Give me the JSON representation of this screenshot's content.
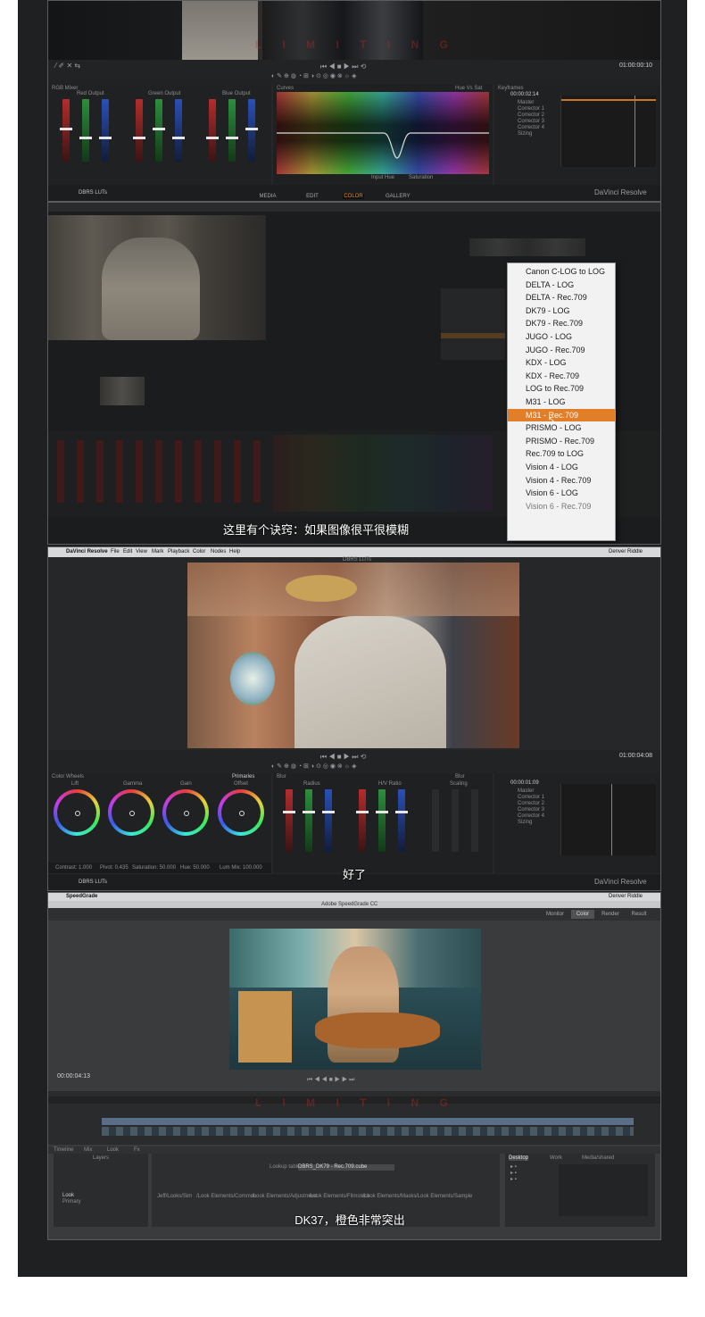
{
  "panel1": {
    "timecode": "01:00:00:10",
    "rgb_mixer_label": "RGB Mixer",
    "channels": [
      "Red Output",
      "Green Output",
      "Blue Output"
    ],
    "curves_label": "Curves",
    "hue_label": "Hue Vs Sat",
    "node_editor_label": "Keyframes",
    "node_timecode": "00:00:02:14",
    "nodes": [
      "Master",
      "Corrector 1",
      "Corrector 2",
      "Corrector 3",
      "Corrector 4",
      "Sizing"
    ],
    "clip_name": "DBRS LUTs",
    "input_hue_label": "Input Hue",
    "saturation_label": "Saturation",
    "brand": "DaVinci Resolve",
    "pages": [
      "MEDIA",
      "EDIT",
      "COLOR",
      "GALLERY"
    ],
    "watermark": "L I M I T I N G"
  },
  "panel2": {
    "lut_menu": {
      "items": [
        "Canon C-LOG to LOG",
        "DELTA - LOG",
        "DELTA - Rec.709",
        "DK79 - LOG",
        "DK79 - Rec.709",
        "JUGO - LOG",
        "JUGO - Rec.709",
        "KDX - LOG",
        "KDX - Rec.709",
        "LOG to Rec.709",
        "M31 - LOG",
        "M31 - Rec.709",
        "PRISMO - LOG",
        "PRISMO - Rec.709",
        "Rec.709 to LOG",
        "Vision 4 - LOG",
        "Vision 4 - Rec.709",
        "Vision 6 - LOG",
        "Vision 6 - Rec.709"
      ],
      "selected_index": 11
    },
    "subtitle": "这里有个诀窍：如果图像很平很模糊"
  },
  "panel3": {
    "menubar": [
      "DaVinci Resolve",
      "File",
      "Edit",
      "View",
      "Mark",
      "Playback",
      "Color",
      "Nodes",
      "Help"
    ],
    "user": "Denver Riddle",
    "clip_name": "DBRS LUTs",
    "timecode": "01:00:04:08",
    "wheels_label": "Color Wheels",
    "primaries_label": "Primaries",
    "wheels": [
      "Lift",
      "Gamma",
      "Gain",
      "Offset"
    ],
    "blur_label": "Blur",
    "radius_label": "Radius",
    "hv_ratio_label": "H/V Ratio",
    "scaling_label": "Scaling",
    "node_timecode": "00:00:01:09",
    "nodes": [
      "Master",
      "Corrector 1",
      "Corrector 2",
      "Corrector 3",
      "Corrector 4",
      "Sizing"
    ],
    "params": {
      "contrast": "Contrast: 1.000",
      "pivot": "Pivot: 0.435",
      "saturation": "Saturation: 50.000",
      "hue": "Hue: 50.000",
      "lum_mix": "Lum Mix: 100.000"
    },
    "subtitle": "好了",
    "brand": "DaVinci Resolve"
  },
  "panel4": {
    "app_name": "SpeedGrade",
    "window_title": "Adobe SpeedGrade CC",
    "user": "Denver Riddle",
    "tabs": [
      "Monitor",
      "Color",
      "Render",
      "Result"
    ],
    "timecode": "00:00:04:13",
    "layers_label": "Layers",
    "layers": [
      "Look",
      "Primary"
    ],
    "lookup_label": "Lookup table",
    "lookup_value": "DBRS_DK79 - Rec.709.cube",
    "bottom_tabs": [
      "Timeline",
      "Mix",
      "Look",
      "Fx"
    ],
    "look_tabs": [
      "Jeff/Looks/Sim",
      "/Look Elements/Common",
      "/Look Elements/Adjustment",
      "/Look Elements/Filmstock",
      "/Look Elements/Masks",
      "/Look Elements/Sample"
    ],
    "browser_tabs": [
      "Desktop",
      "Work",
      "Media/shared"
    ],
    "subtitle": "DK37，橙色非常突出"
  }
}
